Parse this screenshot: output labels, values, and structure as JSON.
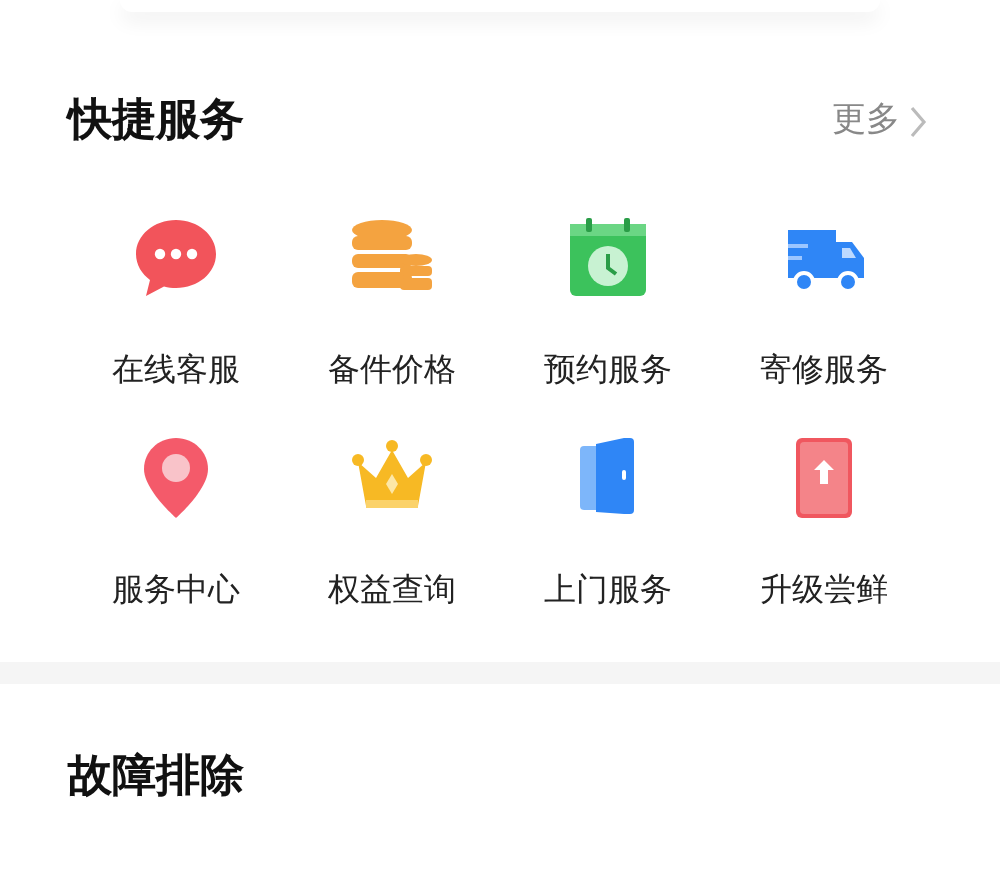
{
  "quick_services": {
    "title": "快捷服务",
    "more": "更多",
    "items": [
      {
        "label": "在线客服"
      },
      {
        "label": "备件价格"
      },
      {
        "label": "预约服务"
      },
      {
        "label": "寄修服务"
      },
      {
        "label": "服务中心"
      },
      {
        "label": "权益查询"
      },
      {
        "label": "上门服务"
      },
      {
        "label": "升级尝鲜"
      }
    ]
  },
  "troubleshooting": {
    "title": "故障排除"
  }
}
